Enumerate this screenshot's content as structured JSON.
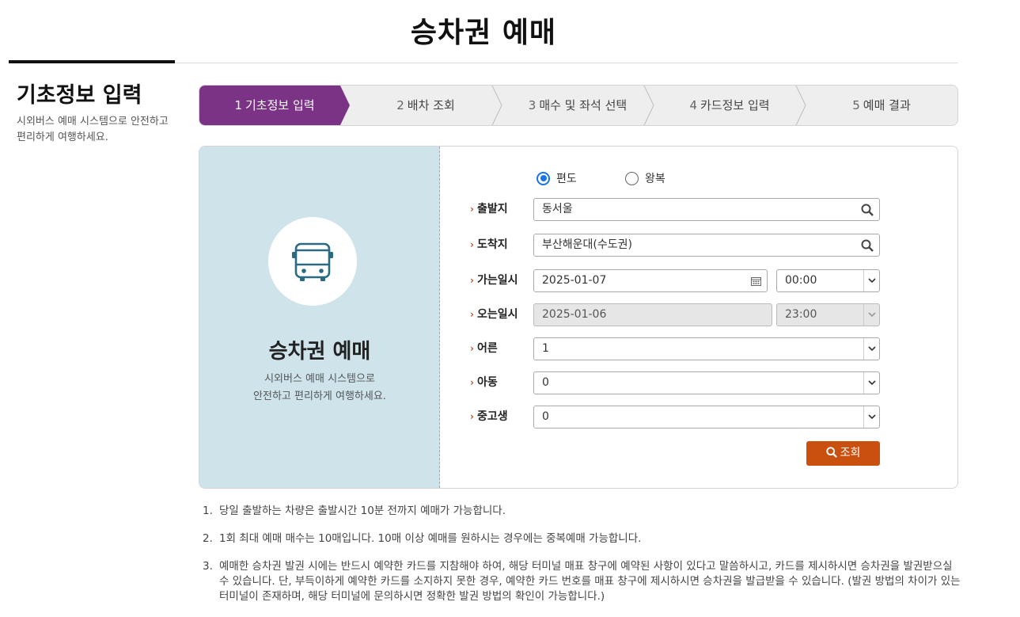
{
  "header": {
    "title": "승차권 예매"
  },
  "side": {
    "title": "기초정보 입력",
    "description": "시외버스 예매 시스템으로 안전하고 편리하게 여행하세요."
  },
  "steps": [
    {
      "num": "1",
      "label": "기초정보 입력",
      "active": true
    },
    {
      "num": "2",
      "label": "배차 조회",
      "active": false
    },
    {
      "num": "3",
      "label": "매수 및 좌석 선택",
      "active": false
    },
    {
      "num": "4",
      "label": "카드정보 입력",
      "active": false
    },
    {
      "num": "5",
      "label": "예매 결과",
      "active": false
    }
  ],
  "card_left": {
    "icon": "bus-icon",
    "title": "승차권 예매",
    "desc_line1": "시외버스 예매 시스템으로",
    "desc_line2": "안전하고 편리하게 여행하세요."
  },
  "trip_type": {
    "one_way": "편도",
    "round_trip": "왕복",
    "selected": "편도"
  },
  "form": {
    "departure": {
      "label": "출발지",
      "value": "동서울"
    },
    "arrival": {
      "label": "도착지",
      "value": "부산해운대(수도권)"
    },
    "go_date": {
      "label": "가는일시",
      "date": "2025-01-07",
      "time": "00:00"
    },
    "return_date": {
      "label": "오는일시",
      "date": "2025-01-06",
      "time": "23:00"
    },
    "adult": {
      "label": "어른",
      "value": "1"
    },
    "child": {
      "label": "아동",
      "value": "0"
    },
    "student": {
      "label": "중고생",
      "value": "0"
    },
    "search_label": "조회"
  },
  "notes": [
    {
      "num": "1.",
      "text": "당일 출발하는 차량은 출발시간 10분 전까지 예매가 가능합니다."
    },
    {
      "num": "2.",
      "text": "1회 최대 예매 매수는 10매입니다. 10매 이상 예매를 원하시는 경우에는 중복예매 가능합니다."
    },
    {
      "num": "3.",
      "text": "예매한 승차권 발권 시에는 반드시 예약한 카드를 지참해야 하여, 해당 터미널 매표 창구에 예약된 사항이 있다고 말씀하시고, 카드를 제시하시면 승차권을 발권받으실 수 있습니다. 단, 부득이하게 예약한 카드를 소지하지 못한 경우, 예약한 카드 번호를 매표 창구에 제시하시면 승차권을 발급받을 수 있습니다. (발권 방법의 차이가 있는 터미널이 존재하며, 해당 터미널에 문의하시면 정확한 발권 방법의 확인이 가능합니다.)"
    }
  ],
  "colors": {
    "active_step": "#7a3385",
    "search_button": "#c9500f",
    "left_panel": "#cfe4ea",
    "label_arrow": "#c0501e"
  }
}
